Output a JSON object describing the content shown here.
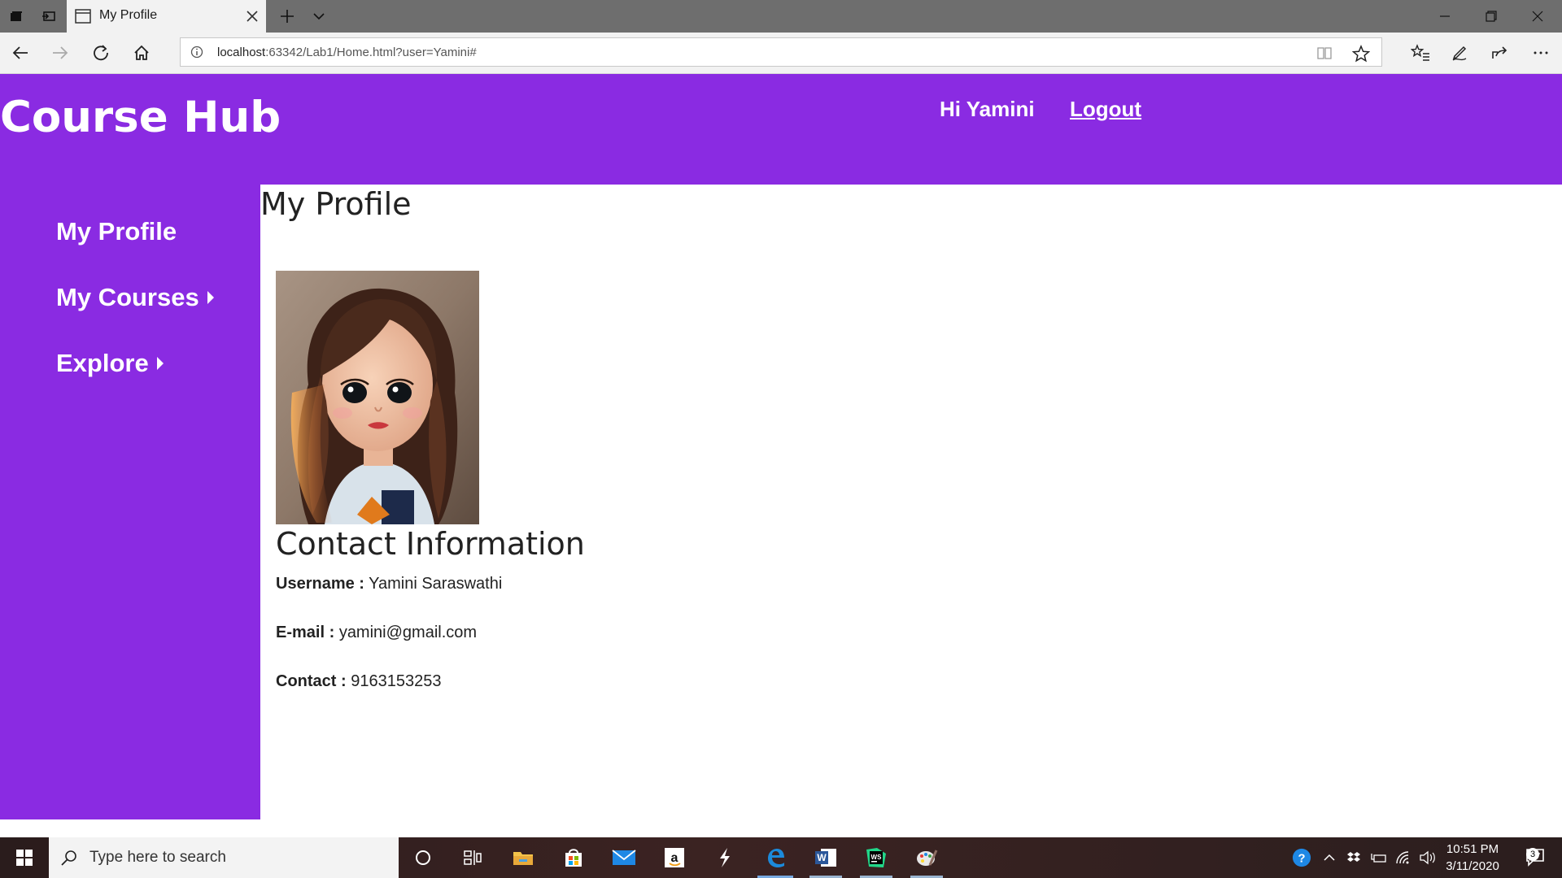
{
  "browser": {
    "tab_title": "My Profile",
    "url_host": "localhost",
    "url_path": ":63342/Lab1/Home.html?user=Yamini#"
  },
  "header": {
    "site_title": "Course Hub",
    "greeting": "Hi Yamini",
    "logout_label": "Logout"
  },
  "sidebar": {
    "items": [
      {
        "label": "My Profile",
        "has_submenu": false
      },
      {
        "label": "My Courses",
        "has_submenu": true
      },
      {
        "label": "Explore",
        "has_submenu": true
      }
    ]
  },
  "main": {
    "page_title": "My Profile",
    "contact_heading": "Contact Information",
    "fields": [
      {
        "label": "Username :",
        "value": "Yamini Saraswathi"
      },
      {
        "label": "E-mail :",
        "value": "yamini@gmail.com"
      },
      {
        "label": "Contact :",
        "value": "9163153253"
      }
    ]
  },
  "taskbar": {
    "search_placeholder": "Type here to search",
    "time": "10:51 PM",
    "date": "3/11/2020",
    "notification_count": "3"
  },
  "colors": {
    "brand_purple": "#8a2be2",
    "text_dark": "#222222"
  }
}
